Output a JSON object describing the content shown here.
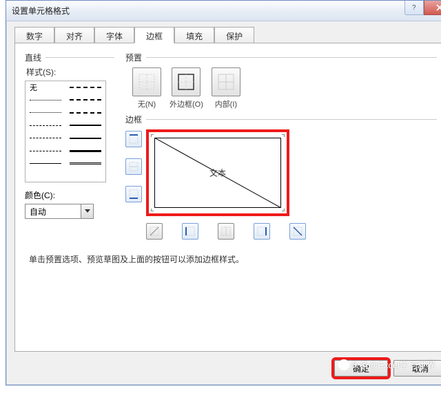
{
  "window": {
    "title": "设置单元格格式"
  },
  "tabs": [
    "数字",
    "对齐",
    "字体",
    "边框",
    "填充",
    "保护"
  ],
  "active_tab_index": 3,
  "group": {
    "line": "直线",
    "preset": "预置",
    "border": "边框"
  },
  "style_label": "样式(S):",
  "style_none": "无",
  "color_label": "颜色(C):",
  "color_value": "自动",
  "presets": {
    "none": "无(N)",
    "outline": "外边框(O)",
    "inside": "内部(I)"
  },
  "preview_text": "文本",
  "hint": "单击预置选项、预览草图及上面的按钮可以添加边框样式。",
  "buttons": {
    "ok": "确定",
    "cancel": "取消"
  },
  "watermark": "头条@Excel学习世界"
}
